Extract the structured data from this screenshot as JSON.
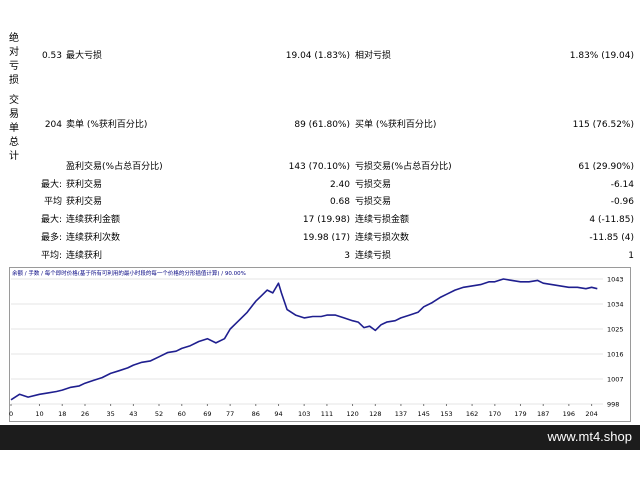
{
  "colors": {
    "line": "#1f1f8f",
    "grid": "#e6e6e6",
    "footer": "#1c1c1c"
  },
  "report": {
    "label_absolute": [
      "绝",
      "对",
      "亏",
      "损"
    ],
    "label_trades": [
      "交",
      "易",
      "单",
      "总",
      "计"
    ],
    "row1": {
      "v1": "0.53",
      "l2": "最大亏损",
      "v2": "19.04 (1.83%)",
      "l3": "相对亏损",
      "v3": "1.83% (19.04)"
    },
    "row2": {
      "v1": "204",
      "l2": "卖单 (%获利百分比)",
      "v2": "89 (61.80%)",
      "l3": "买单 (%获利百分比)",
      "v3": "115 (76.52%)"
    },
    "row3": {
      "l2": "盈利交易(%占总百分比)",
      "v2": "143 (70.10%)",
      "l3": "亏损交易(%占总百分比)",
      "v3": "61 (29.90%)"
    },
    "row4": {
      "p": "最大:",
      "l2": "获利交易",
      "v2": "2.40",
      "l3": "亏损交易",
      "v3": "-6.14"
    },
    "row5": {
      "p": "平均",
      "l2": "获利交易",
      "v2": "0.68",
      "l3": "亏损交易",
      "v3": "-0.96"
    },
    "row6": {
      "p": "最大:",
      "l2": "连续获利金额",
      "v2": "17 (19.98)",
      "l3": "连续亏损金额",
      "v3": "4 (-11.85)"
    },
    "row7": {
      "p": "最多:",
      "l2": "连续获利次数",
      "v2": "19.98 (17)",
      "l3": "连续亏损次数",
      "v3": "-11.85 (4)"
    },
    "row8": {
      "p": "平均:",
      "l2": "连续获利",
      "v2": "3",
      "l3": "连续亏损",
      "v3": "1"
    }
  },
  "chart_data": {
    "type": "line",
    "legend_text": "余额 / 手数 / 每个即时价格(基于所有可利用的最小时段的每一个价格的分形插值计算) / 90.00%",
    "x_ticks": [
      "0",
      "10",
      "18",
      "26",
      "35",
      "43",
      "52",
      "60",
      "69",
      "77",
      "86",
      "94",
      "103",
      "111",
      "120",
      "128",
      "137",
      "145",
      "153",
      "162",
      "170",
      "179",
      "187",
      "196",
      "204"
    ],
    "y_ticks": [
      "1043",
      "1034",
      "1025",
      "1016",
      "1007",
      "998"
    ],
    "ylim": [
      998,
      1043
    ],
    "xlim": [
      0,
      208
    ],
    "series": [
      {
        "x": [
          0,
          3,
          6,
          10,
          13,
          16,
          18,
          21,
          24,
          26,
          29,
          32,
          35,
          38,
          41,
          43,
          46,
          49,
          52,
          55,
          58,
          60,
          63,
          66,
          69,
          72,
          75,
          77,
          80,
          83,
          86,
          88,
          90,
          92,
          94,
          95,
          97,
          100,
          103,
          106,
          109,
          111,
          114,
          117,
          120,
          122,
          124,
          126,
          128,
          130,
          132,
          135,
          137,
          140,
          143,
          145,
          148,
          151,
          153,
          156,
          159,
          162,
          165,
          168,
          170,
          173,
          176,
          179,
          182,
          185,
          187,
          190,
          193,
          196,
          199,
          202,
          204,
          206
        ],
        "y": [
          999.5,
          1001.5,
          1000.5,
          1001.5,
          1002.0,
          1002.5,
          1003.0,
          1004.0,
          1004.5,
          1005.5,
          1006.5,
          1007.5,
          1009.0,
          1010.0,
          1011.0,
          1012.0,
          1013.0,
          1013.5,
          1015.0,
          1016.5,
          1017.0,
          1018.0,
          1019.0,
          1020.5,
          1021.5,
          1020.0,
          1021.5,
          1025.0,
          1028.0,
          1031.0,
          1035.0,
          1037.0,
          1039.0,
          1038.0,
          1041.5,
          1038.0,
          1032.0,
          1030.0,
          1029.0,
          1029.5,
          1029.5,
          1030.0,
          1030.0,
          1029.0,
          1028.0,
          1027.5,
          1025.5,
          1026.0,
          1024.5,
          1026.5,
          1027.5,
          1028.0,
          1029.0,
          1030.0,
          1031.0,
          1033.0,
          1034.5,
          1036.5,
          1037.5,
          1039.0,
          1040.0,
          1040.5,
          1041.0,
          1042.0,
          1042.0,
          1043.0,
          1042.5,
          1042.0,
          1042.0,
          1042.5,
          1041.5,
          1041.0,
          1040.5,
          1040.0,
          1040.0,
          1039.5,
          1040.0,
          1039.5
        ]
      }
    ]
  },
  "footer": {
    "site": "www.mt4.shop"
  }
}
